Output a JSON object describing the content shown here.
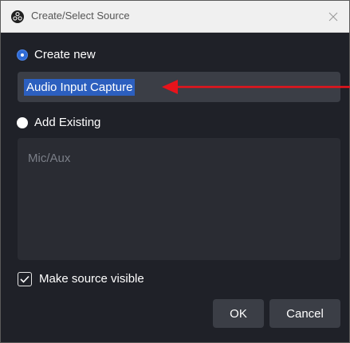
{
  "window": {
    "title": "Create/Select Source",
    "close_icon": "close-icon",
    "app_icon": "obs-logo-icon"
  },
  "create_new": {
    "label": "Create new",
    "checked": true,
    "name_value": "Audio Input Capture",
    "selected": true
  },
  "add_existing": {
    "label": "Add Existing",
    "checked": false,
    "items": [
      "Mic/Aux"
    ]
  },
  "visibility": {
    "label": "Make source visible",
    "checked": true
  },
  "buttons": {
    "ok": "OK",
    "cancel": "Cancel"
  },
  "annotation": {
    "arrow_color": "#e8131b",
    "arrow_icon": "red-arrow-left-icon"
  },
  "colors": {
    "accent": "#2f6bd6",
    "dialog_bg": "#1f2128",
    "input_bg": "#3b3e46"
  }
}
